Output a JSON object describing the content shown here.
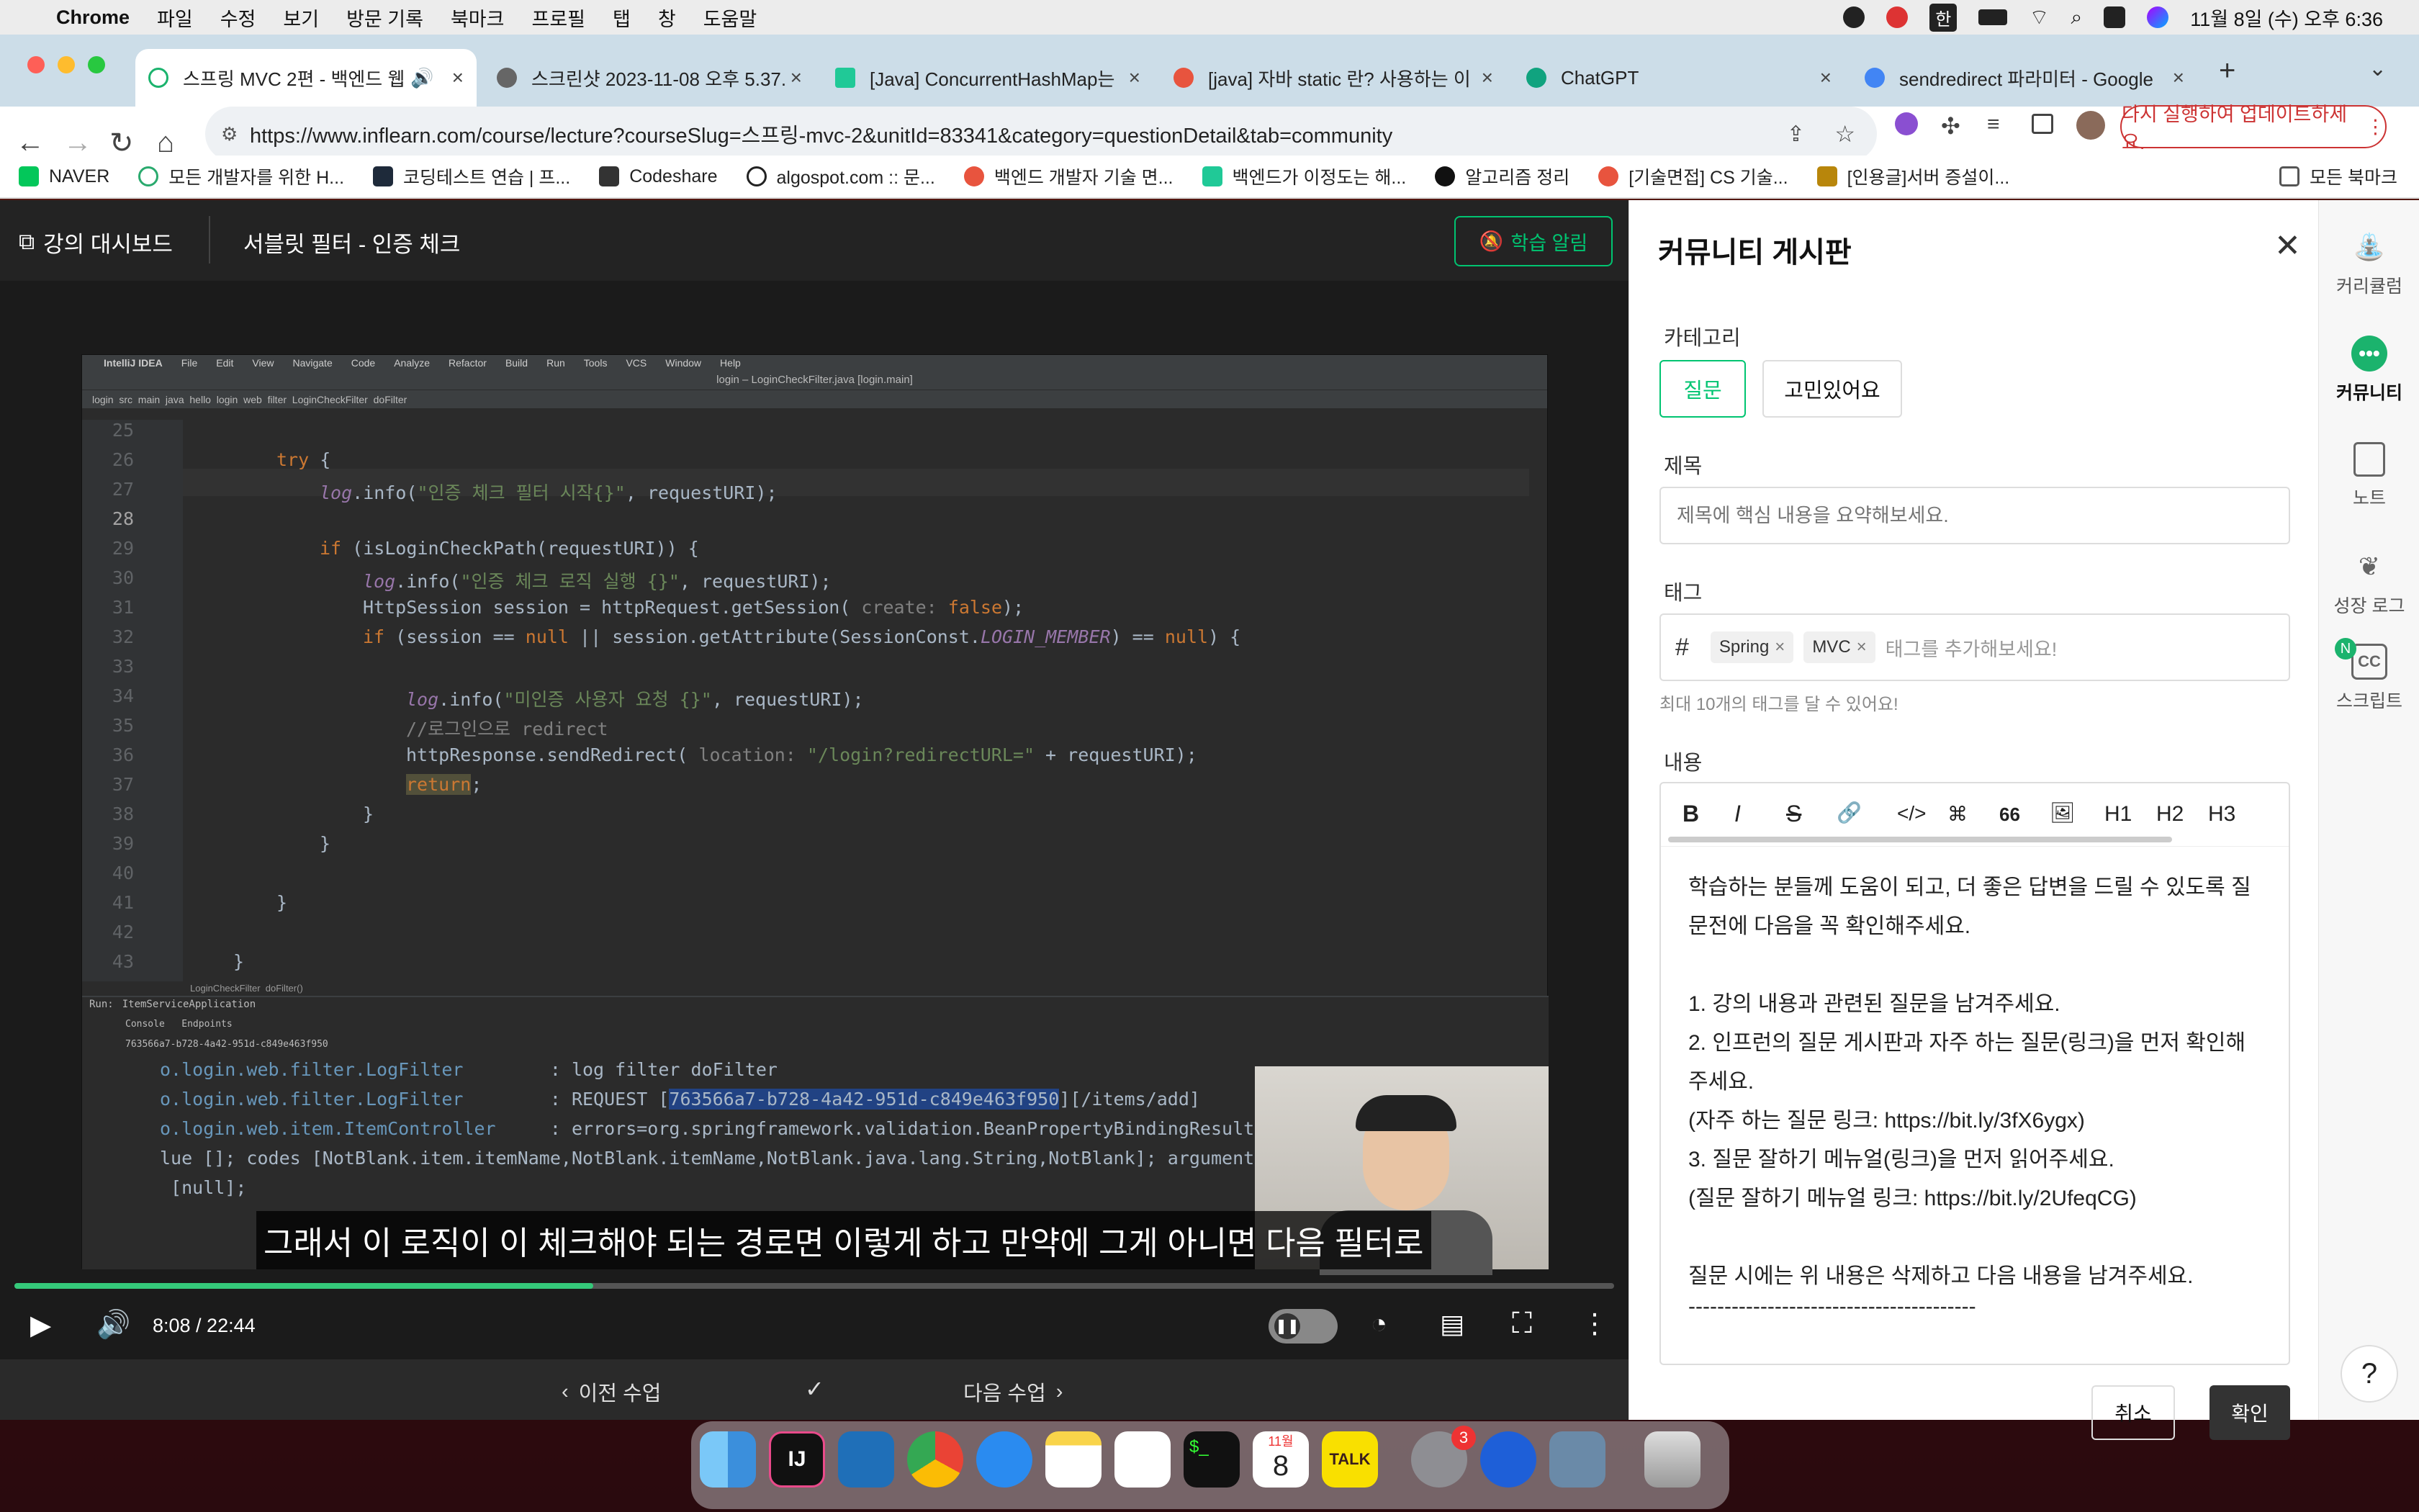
{
  "menubar": {
    "app": "Chrome",
    "items": [
      "파일",
      "수정",
      "보기",
      "방문 기록",
      "북마크",
      "프로필",
      "탭",
      "창",
      "도움말"
    ],
    "ime": "한",
    "clock": "11월 8일 (수) 오후 6:36"
  },
  "tabs": [
    {
      "title": "스프링 MVC 2편 - 백엔드 웹 ",
      "color": "#1bb36d"
    },
    {
      "title": "스크린샷 2023-11-08 오후 5.37.",
      "color": "#666666"
    },
    {
      "title": "[Java] ConcurrentHashMap는 ",
      "color": "#20c997"
    },
    {
      "title": "[java] 자바 static 란? 사용하는 이",
      "color": "#e8543e"
    },
    {
      "title": "ChatGPT",
      "color": "#10a37f"
    },
    {
      "title": "sendredirect 파라미터 - Google ",
      "color": "#4285f4"
    }
  ],
  "toolbar": {
    "url": "https://www.inflearn.com/course/lecture?courseSlug=스프링-mvc-2&unitId=83341&category=questionDetail&tab=community",
    "update_label": "다시 실행하여 업데이트하세요."
  },
  "bookmarks": [
    {
      "label": "NAVER",
      "color": "#03c75a"
    },
    {
      "label": "모든 개발자를 위한 H...",
      "color": "#2aaa6e"
    },
    {
      "label": "코딩테스트 연습 | 프...",
      "color": "#1e2a3a"
    },
    {
      "label": "Codeshare",
      "color": "#333333"
    },
    {
      "label": "algospot.com :: 문...",
      "color": "#222222"
    },
    {
      "label": "백엔드 개발자 기술 면...",
      "color": "#e8543e"
    },
    {
      "label": "백엔드가 이정도는 해...",
      "color": "#20c997"
    },
    {
      "label": "알고리즘 정리",
      "color": "#111111"
    },
    {
      "label": "[기술면접] CS 기술...",
      "color": "#e8543e"
    },
    {
      "label": "[인용글]서버 증설이...",
      "color": "#b8860b"
    }
  ],
  "bookmarks_all": "모든 북마크",
  "player": {
    "dashboard": "강의 대시보드",
    "lecture_title": "서블릿 필터 - 인증 체크",
    "alarm": "학습 알림",
    "time": "8:08 / 22:44",
    "progress": 0.362,
    "subtitle": "그래서 이 로직이 이 체크해야 되는 경로면 이렇게 하고 만약에 그게 아니면 다음 필터로",
    "prev": "이전 수업",
    "next": "다음 수업"
  },
  "ide": {
    "menu": [
      "IntelliJ IDEA",
      "File",
      "Edit",
      "View",
      "Navigate",
      "Code",
      "Analyze",
      "Refactor",
      "Build",
      "Run",
      "Tools",
      "VCS",
      "Window",
      "Help"
    ],
    "file_title": "login – LoginCheckFilter.java [login.main]",
    "breadcrumb": "login  src  main  java  hello  login  web  filter  LoginCheckFilter  doFilter",
    "footer_crumb": "LoginCheckFilter  doFilter()",
    "run_label": "Run:",
    "run_app": "ItemServiceApplication",
    "console_tabs": "Console   Endpoints",
    "session_id": "763566a7-b728-4a42-951d-c849e463f950",
    "lines": [
      {
        "n": "25"
      },
      {
        "n": "26"
      },
      {
        "n": "27"
      },
      {
        "n": "28"
      },
      {
        "n": "29"
      },
      {
        "n": "30"
      },
      {
        "n": "31"
      },
      {
        "n": "32"
      },
      {
        "n": "33"
      },
      {
        "n": "34"
      },
      {
        "n": "35"
      },
      {
        "n": "36"
      },
      {
        "n": "37"
      },
      {
        "n": "38"
      },
      {
        "n": "39"
      },
      {
        "n": "40"
      },
      {
        "n": "41"
      },
      {
        "n": "42"
      },
      {
        "n": "43"
      }
    ],
    "console": {
      "l1_pkg": "o.login.web.filter.LogFilter",
      "l1_msg": "        : log filter doFilter",
      "l2_pkg": "o.login.web.filter.LogFilter",
      "l2_pre": "        : REQUEST [",
      "l2_sel": "763566a7-b728-4a42-951d-c849e463f950",
      "l2_post": "][/items/add]",
      "l3_pkg": "o.login.web.item.ItemController",
      "l3_msg": "     : errors=org.springframework.validation.BeanPropertyBindingResult:",
      "l4": "lue []; codes [NotBlank.item.itemName,NotBlank.itemName,NotBlank.java.lang.String,NotBlank]; arguments",
      "l5": " [null];"
    }
  },
  "panel": {
    "title": "커뮤니티 게시판",
    "category_label": "카테고리",
    "categories": [
      "질문",
      "고민있어요"
    ],
    "subject_label": "제목",
    "subject_placeholder": "제목에 핵심 내용을 요약해보세요.",
    "tag_label": "태그",
    "tags": [
      "Spring",
      "MVC"
    ],
    "tag_placeholder": "태그를 추가해보세요!",
    "tag_hint": "최대 10개의 태그를 달 수 있어요!",
    "content_label": "내용",
    "editor_tools": [
      "B",
      "I",
      "S",
      "🔗",
      "</>",
      "⌘",
      "66",
      "🖼",
      "H1",
      "H2",
      "H3"
    ],
    "content_lines": [
      "학습하는 분들께 도움이 되고, 더 좋은 답변을 드릴 수 있도록 질",
      "문전에 다음을 꼭 확인해주세요.",
      "",
      "1. 강의 내용과 관련된 질문을 남겨주세요.",
      "2. 인프런의 질문 게시판과 자주 하는 질문(링크)을 먼저 확인해",
      "주세요.",
      "(자주 하는 질문 링크: https://bit.ly/3fX6ygx)",
      "3. 질문 잘하기 메뉴얼(링크)을 먼저 읽어주세요.",
      "(질문 잘하기 메뉴얼 링크: https://bit.ly/2UfeqCG)",
      "",
      "질문 시에는 위 내용은 삭제하고 다음 내용을 남겨주세요.",
      "----------------------------------------"
    ],
    "cancel": "취소",
    "confirm": "확인"
  },
  "sidebar": [
    {
      "label": "커리큘럼",
      "icon": "curriculum-icon"
    },
    {
      "label": "커뮤니티",
      "icon": "community-icon"
    },
    {
      "label": "노트",
      "icon": "note-icon"
    },
    {
      "label": "성장 로그",
      "icon": "growth-log-icon"
    },
    {
      "label": "스크립트",
      "icon": "script-icon"
    }
  ],
  "sidebar_badge": "N",
  "help": "?",
  "dock": {
    "calendar_month": "11월",
    "calendar_day": "8",
    "settings_badge": "3",
    "talk": "TALK"
  },
  "colors": {
    "accent": "#00c471",
    "alarm_border": "#00c471"
  }
}
